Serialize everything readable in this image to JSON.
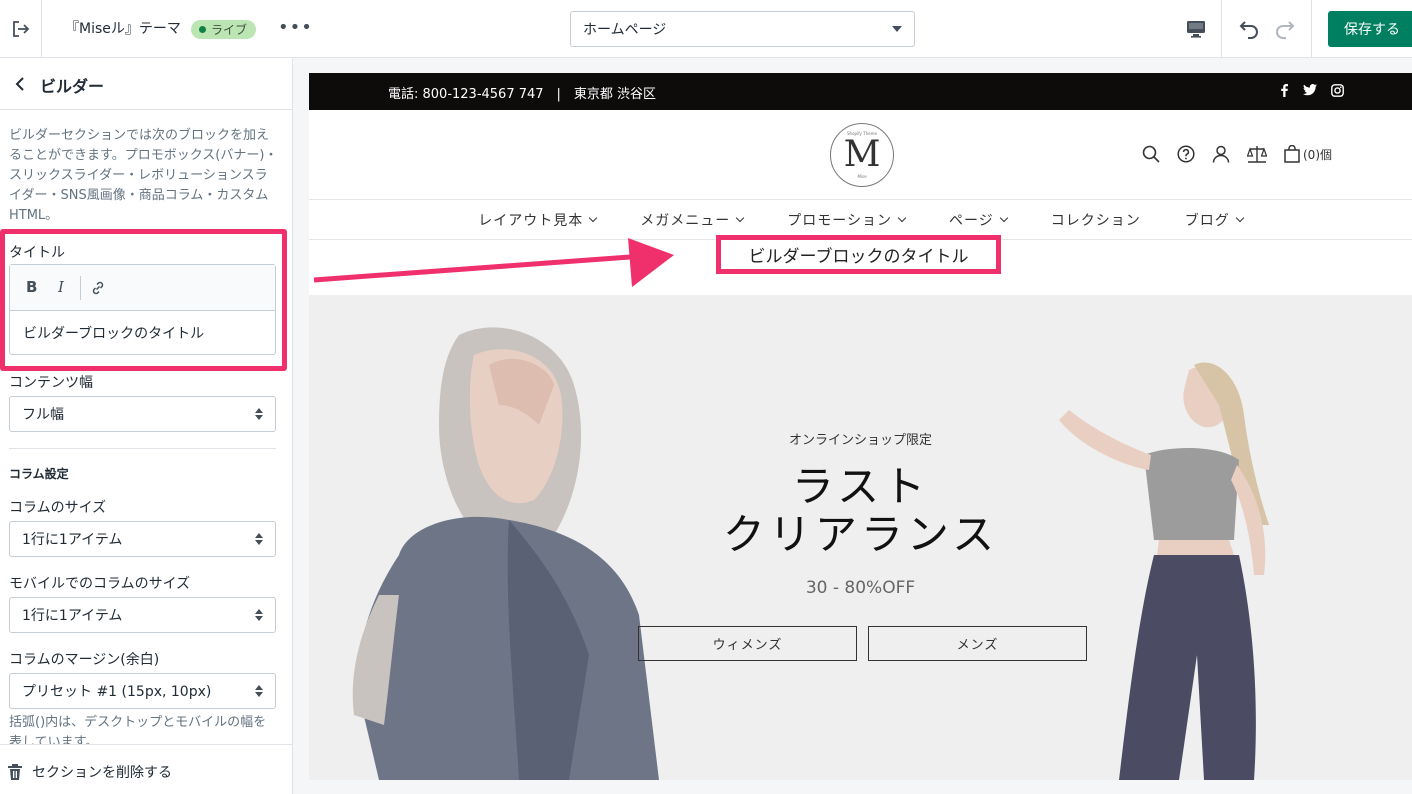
{
  "topbar": {
    "theme_name": "『Miseル』テーマ",
    "live_badge": "ライブ",
    "page_select": "ホームページ",
    "save_label": "保存する"
  },
  "sidebar": {
    "title": "ビルダー",
    "description": "ビルダーセクションでは次のブロックを加えることができます。プロモボックス(バナー)・スリックスライダー・レボリューションスライダー・SNS風画像・商品コラム・カスタムHTML。",
    "title_label": "タイトル",
    "title_value": "ビルダーブロックのタイトル",
    "content_width_label": "コンテンツ幅",
    "content_width_value": "フル幅",
    "column_group": "コラム設定",
    "column_size_label": "コラムのサイズ",
    "column_size_value": "1行に1アイテム",
    "mobile_column_size_label": "モバイルでのコラムのサイズ",
    "mobile_column_size_value": "1行に1アイテム",
    "column_margin_label": "コラムのマージン(余白)",
    "column_margin_value": "プリセット #1 (15px, 10px)",
    "help_text": "括弧()内は、デスクトップとモバイルの幅を表しています。",
    "delete_label": "セクションを削除する"
  },
  "preview": {
    "announcement": "電話: 800-123-4567 747　|　東京都 渋谷区",
    "logo": {
      "top": "Shopify Theme",
      "letter": "M",
      "bottom": "Mise"
    },
    "cart_count": "(0)個",
    "nav": [
      "レイアウト見本",
      "メガメニュー",
      "プロモーション",
      "ページ",
      "コレクション",
      "ブログ"
    ],
    "builder_title": "ビルダーブロックのタイトル",
    "hero": {
      "subtitle": "オンラインショップ限定",
      "title_line1": "ラスト",
      "title_line2": "クリアランス",
      "discount": "30 - 80%OFF",
      "button_women": "ウィメンズ",
      "button_men": "メンズ"
    }
  },
  "colors": {
    "accent": "#f0306d",
    "save": "#008060",
    "live": "#bbe5b3"
  }
}
